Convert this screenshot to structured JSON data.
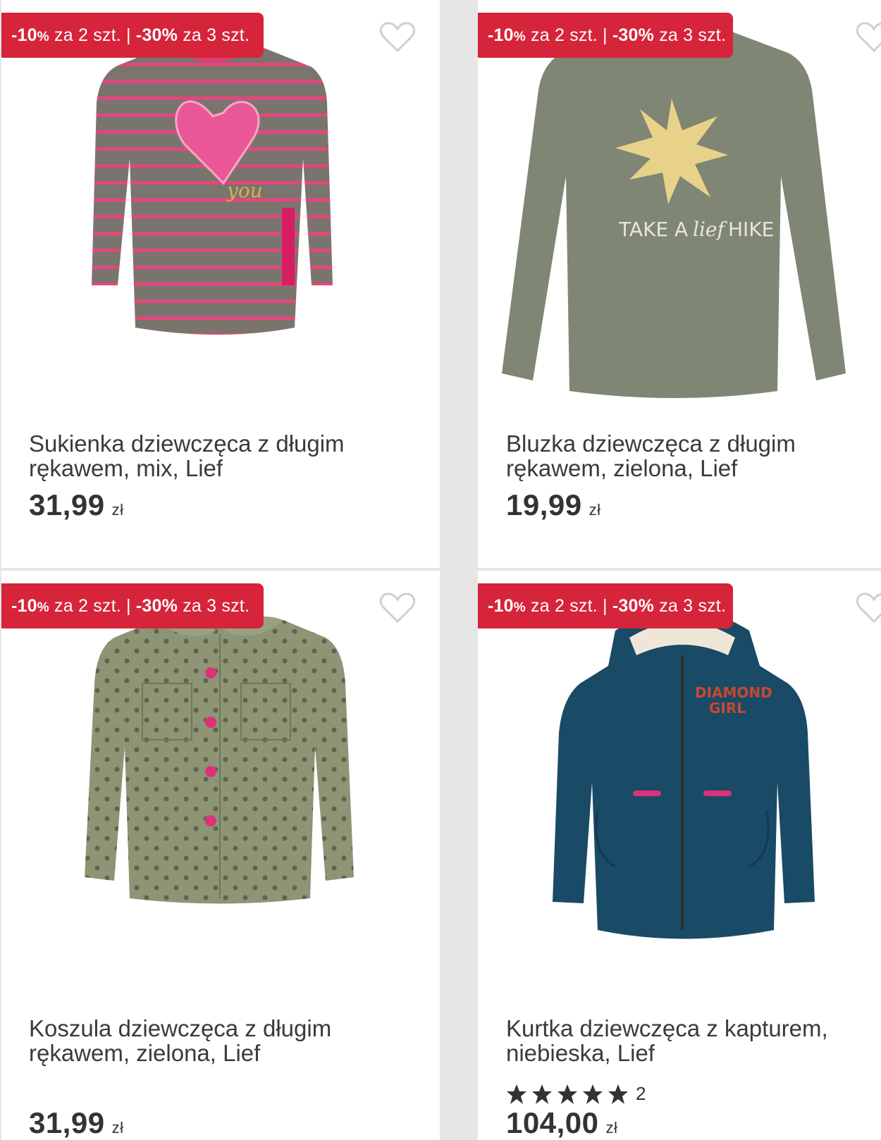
{
  "promo": {
    "part1_pct": "-10",
    "part1_sign": "%",
    "part1_text": " za 2 szt. | ",
    "part2_pct": "-30%",
    "part2_text": " za 3 szt."
  },
  "colors": {
    "badge": "#d6243b",
    "heart": "#cfcfcf",
    "star": "#333333"
  },
  "products": [
    {
      "name": "Sukienka dziewczęca z długim rękawem, mix, Lief",
      "price": "31,99",
      "currency": "zł",
      "image": "striped-heart-dress"
    },
    {
      "name": "Bluzka dziewczęca z długim rękawem, zielona, Lief",
      "price": "19,99",
      "currency": "zł",
      "image": "green-star-blouse"
    },
    {
      "name": "Koszula dziewczęca z długim rękawem, zielona, Lief",
      "price": "31,99",
      "currency": "zł",
      "image": "green-heart-print-shirt"
    },
    {
      "name": "Kurtka dziewczęca z kapturem, niebieska, Lief",
      "price": "104,00",
      "currency": "zł",
      "image": "navy-hooded-jacket",
      "rating_value": 5,
      "rating_count": "2"
    }
  ]
}
